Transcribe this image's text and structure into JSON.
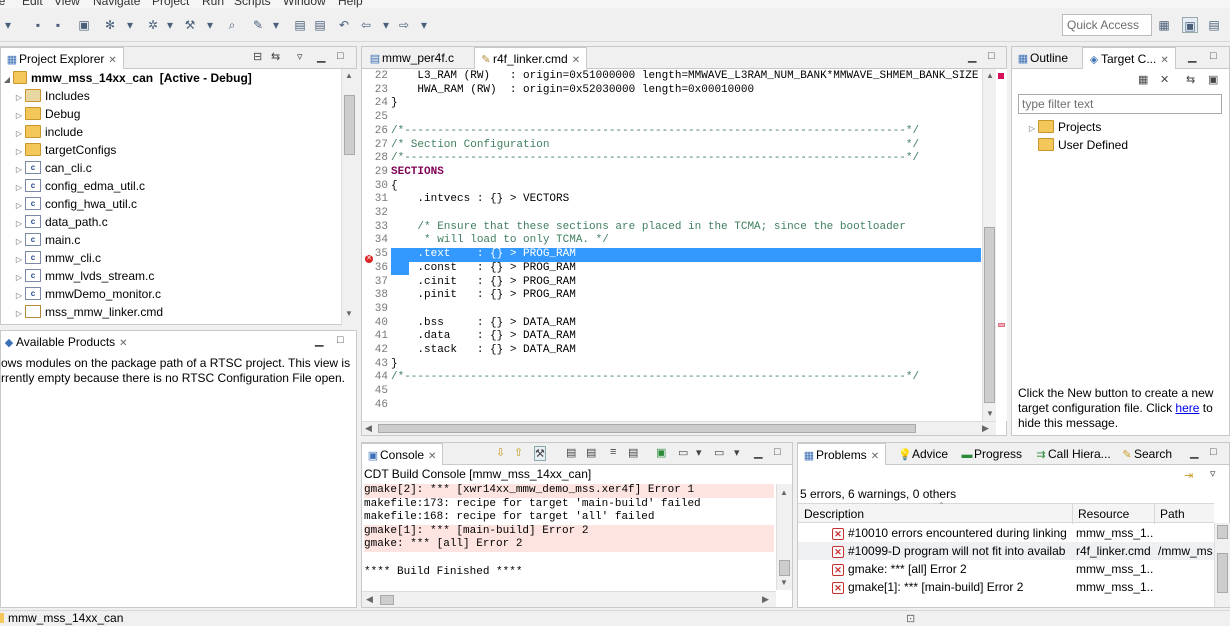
{
  "menu": [
    "le",
    "Edit",
    "View",
    "Navigate",
    "Project",
    "Run",
    "Scripts",
    "Window",
    "Help"
  ],
  "quick_access": "Quick Access",
  "project_explorer": {
    "tab_label": "Project Explorer",
    "project_name": "mmw_mss_14xx_can",
    "project_suffix": "[Active - Debug]",
    "items": [
      {
        "label": "Includes",
        "kind": "includes"
      },
      {
        "label": "Debug",
        "kind": "folder"
      },
      {
        "label": "include",
        "kind": "folder"
      },
      {
        "label": "targetConfigs",
        "kind": "folder"
      },
      {
        "label": "can_cli.c",
        "kind": "c"
      },
      {
        "label": "config_edma_util.c",
        "kind": "c"
      },
      {
        "label": "config_hwa_util.c",
        "kind": "c"
      },
      {
        "label": "data_path.c",
        "kind": "c"
      },
      {
        "label": "main.c",
        "kind": "c"
      },
      {
        "label": "mmw_cli.c",
        "kind": "c"
      },
      {
        "label": "mmw_lvds_stream.c",
        "kind": "c"
      },
      {
        "label": "mmwDemo_monitor.c",
        "kind": "c"
      },
      {
        "label": "mss_mmw_linker.cmd",
        "kind": "linker"
      }
    ]
  },
  "available_products": {
    "tab_label": "Available Products",
    "message_line1": "ows modules on the package path of a RTSC project. This view is",
    "message_line2": "rrently empty because there is no RTSC Configuration File open."
  },
  "editor": {
    "tabs": [
      {
        "label": "mmw_per4f.c"
      },
      {
        "label": "r4f_linker.cmd"
      }
    ],
    "lines": [
      {
        "n": "22",
        "text": "    L3_RAM (RW)   : origin=0x51000000 length=MMWAVE_L3RAM_NUM_BANK*MMWAVE_SHMEM_BANK_SIZE",
        "cls": ""
      },
      {
        "n": "23",
        "text": "    HWA_RAM (RW)  : origin=0x52030000 length=0x00010000",
        "cls": ""
      },
      {
        "n": "24",
        "text": "}",
        "cls": ""
      },
      {
        "n": "25",
        "text": "",
        "cls": ""
      },
      {
        "n": "26",
        "text": "/*----------------------------------------------------------------------------*/",
        "cls": "cmt"
      },
      {
        "n": "27",
        "text": "/* Section Configuration                                                      */",
        "cls": "cmt"
      },
      {
        "n": "28",
        "text": "/*----------------------------------------------------------------------------*/",
        "cls": "cmt"
      },
      {
        "n": "29",
        "text": "SECTIONS",
        "cls": "kw"
      },
      {
        "n": "30",
        "text": "{",
        "cls": ""
      },
      {
        "n": "31",
        "text": "    .intvecs : {} > VECTORS",
        "cls": ""
      },
      {
        "n": "32",
        "text": "",
        "cls": ""
      },
      {
        "n": "33",
        "text": "    /* Ensure that these sections are placed in the TCMA; since the bootloader",
        "cls": "cmt"
      },
      {
        "n": "34",
        "text": "     * will load to only TCMA. */",
        "cls": "cmt"
      },
      {
        "n": "35",
        "text": "    .text    : {} > PROG_RAM",
        "cls": "sel"
      },
      {
        "n": "36",
        "text": "    .const   : {} > PROG_RAM",
        "cls": ""
      },
      {
        "n": "37",
        "text": "    .cinit   : {} > PROG_RAM",
        "cls": ""
      },
      {
        "n": "38",
        "text": "    .pinit   : {} > PROG_RAM",
        "cls": ""
      },
      {
        "n": "39",
        "text": "",
        "cls": ""
      },
      {
        "n": "40",
        "text": "    .bss     : {} > DATA_RAM",
        "cls": ""
      },
      {
        "n": "41",
        "text": "    .data    : {} > DATA_RAM",
        "cls": ""
      },
      {
        "n": "42",
        "text": "    .stack   : {} > DATA_RAM",
        "cls": ""
      },
      {
        "n": "43",
        "text": "}",
        "cls": ""
      },
      {
        "n": "44",
        "text": "/*----------------------------------------------------------------------------*/",
        "cls": "cmt"
      },
      {
        "n": "45",
        "text": "",
        "cls": ""
      },
      {
        "n": "46",
        "text": "",
        "cls": ""
      }
    ]
  },
  "outline": {
    "tab_outline": "Outline",
    "tab_target": "Target C...",
    "filter_placeholder": "type filter text",
    "tree": [
      {
        "label": "Projects"
      },
      {
        "label": "User Defined"
      }
    ],
    "msg_before_link": "Click the New button to create a new target configuration file. Click",
    "msg_link": "here",
    "msg_after_link": "to hide this message."
  },
  "console": {
    "tab_label": "Console",
    "title": "CDT Build Console [mmw_mss_14xx_can]",
    "lines": [
      {
        "text": "gmake[2]: *** [xwr14xx_mmw_demo_mss.xer4f] Error 1",
        "err": true
      },
      {
        "text": "makefile:173: recipe for target 'main-build' failed",
        "err": false
      },
      {
        "text": "makefile:168: recipe for target 'all' failed",
        "err": false
      },
      {
        "text": "gmake[1]: *** [main-build] Error 2",
        "err": true
      },
      {
        "text": "gmake: *** [all] Error 2",
        "err": true
      },
      {
        "text": "",
        "err": false
      },
      {
        "text": "**** Build Finished ****",
        "err": false
      }
    ]
  },
  "problems": {
    "tabs": [
      "Problems",
      "Advice",
      "Progress",
      "Call Hiera...",
      "Search"
    ],
    "summary": "5 errors, 6 warnings, 0 others",
    "columns": [
      "Description",
      "Resource",
      "Path"
    ],
    "rows": [
      {
        "desc": "#10010 errors encountered during linking",
        "resource": "mmw_mss_1...",
        "path": ""
      },
      {
        "desc": "#10099-D program will not fit into availab",
        "resource": "r4f_linker.cmd",
        "path": "/mmw_ms"
      },
      {
        "desc": "gmake: *** [all] Error 2",
        "resource": "mmw_mss_1...",
        "path": ""
      },
      {
        "desc": "gmake[1]: *** [main-build] Error 2",
        "resource": "mmw_mss_1...",
        "path": ""
      }
    ]
  },
  "status": {
    "text": "mmw_mss_14xx_can"
  },
  "colors": {
    "selection": "#3399ff",
    "error": "#c83030",
    "link": "#0000ee"
  }
}
